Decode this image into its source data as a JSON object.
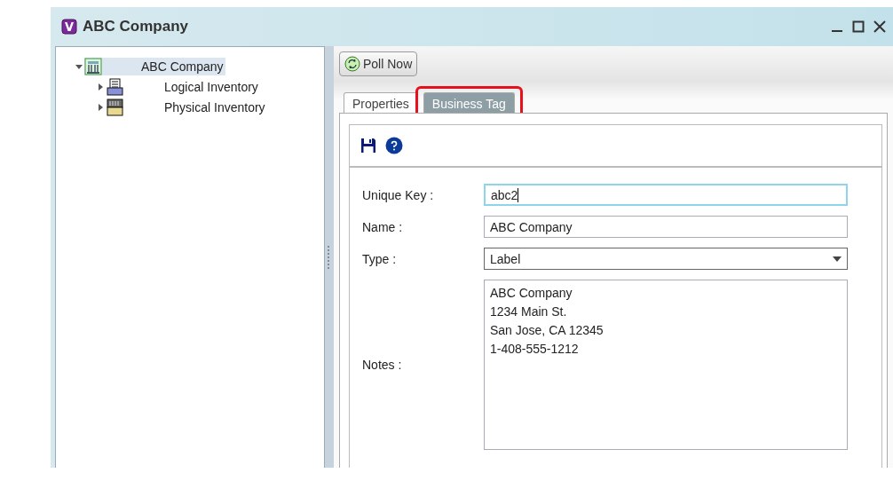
{
  "window": {
    "title": "ABC Company"
  },
  "tree": [
    {
      "label": "ABC Company",
      "kind": "company",
      "expanded": true,
      "selected": true,
      "children": [
        {
          "label": "Logical Inventory",
          "kind": "logical",
          "expanded": false,
          "selected": false
        },
        {
          "label": "Physical Inventory",
          "kind": "physical",
          "expanded": false,
          "selected": false
        }
      ]
    }
  ],
  "poll_button": "Poll Now",
  "tabs": [
    {
      "label": "Properties",
      "selected": false,
      "highlighted": false
    },
    {
      "label": "Business Tag",
      "selected": true,
      "highlighted": true
    }
  ],
  "form": [
    {
      "label": "Unique Key :",
      "kind": "text",
      "value": "abc2",
      "focused": true
    },
    {
      "label": "Name :",
      "kind": "text",
      "value": "ABC Company",
      "focused": false
    },
    {
      "label": "Type :",
      "kind": "select",
      "value": "Label",
      "focused": false
    },
    {
      "label": "Notes :",
      "kind": "area",
      "value": "ABC Company\n1234 Main St.\nSan Jose, CA 12345\n1-408-555-1212",
      "focused": false
    }
  ]
}
